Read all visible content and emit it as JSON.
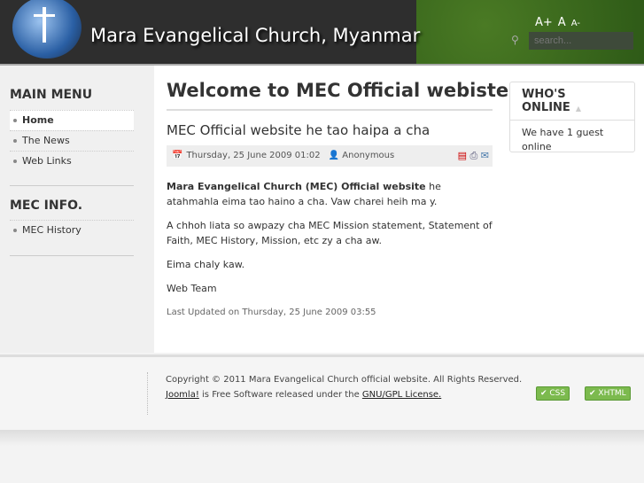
{
  "header": {
    "title": "Mara Evangelical Church, Myanmar",
    "font_sizes": [
      "A+",
      "A",
      "A-"
    ],
    "search_placeholder": "search..."
  },
  "sidebar": {
    "main_menu_title": "MAIN MENU",
    "main_menu": [
      {
        "label": "Home"
      },
      {
        "label": "The News"
      },
      {
        "label": "Web Links"
      }
    ],
    "info_title": "MEC INFO.",
    "info_menu": [
      {
        "label": "MEC History"
      }
    ]
  },
  "main": {
    "heading": "Welcome to MEC Official webiste",
    "article_title": "MEC Official website he tao haipa a cha",
    "date": "Thursday, 25 June 2009 01:02",
    "author": "Anonymous",
    "intro_bold": "Mara Evangelical Church (MEC) Official website",
    "intro_rest": " he atahmahla eima tao haino a cha. Vaw charei heih ma y.",
    "p2": "A chhoh liata so awpazy cha MEC Mission statement, Statement of Faith, MEC History, Mission, etc zy a cha aw.",
    "p3": "Eima chaly kaw.",
    "p4": "Web Team",
    "updated": "Last Updated on Thursday, 25 June 2009 03:55"
  },
  "who": {
    "title": "WHO'S ONLINE",
    "text": "We have 1 guest online"
  },
  "footer": {
    "copyright": "Copyright © 2011 Mara Evangelical Church official website. All Rights Reserved.",
    "joomla": "Joomla!",
    "free": " is Free Software released under the ",
    "license": "GNU/GPL License.",
    "css_badge": "✔ CSS",
    "xhtml_badge": "✔ XHTML"
  }
}
